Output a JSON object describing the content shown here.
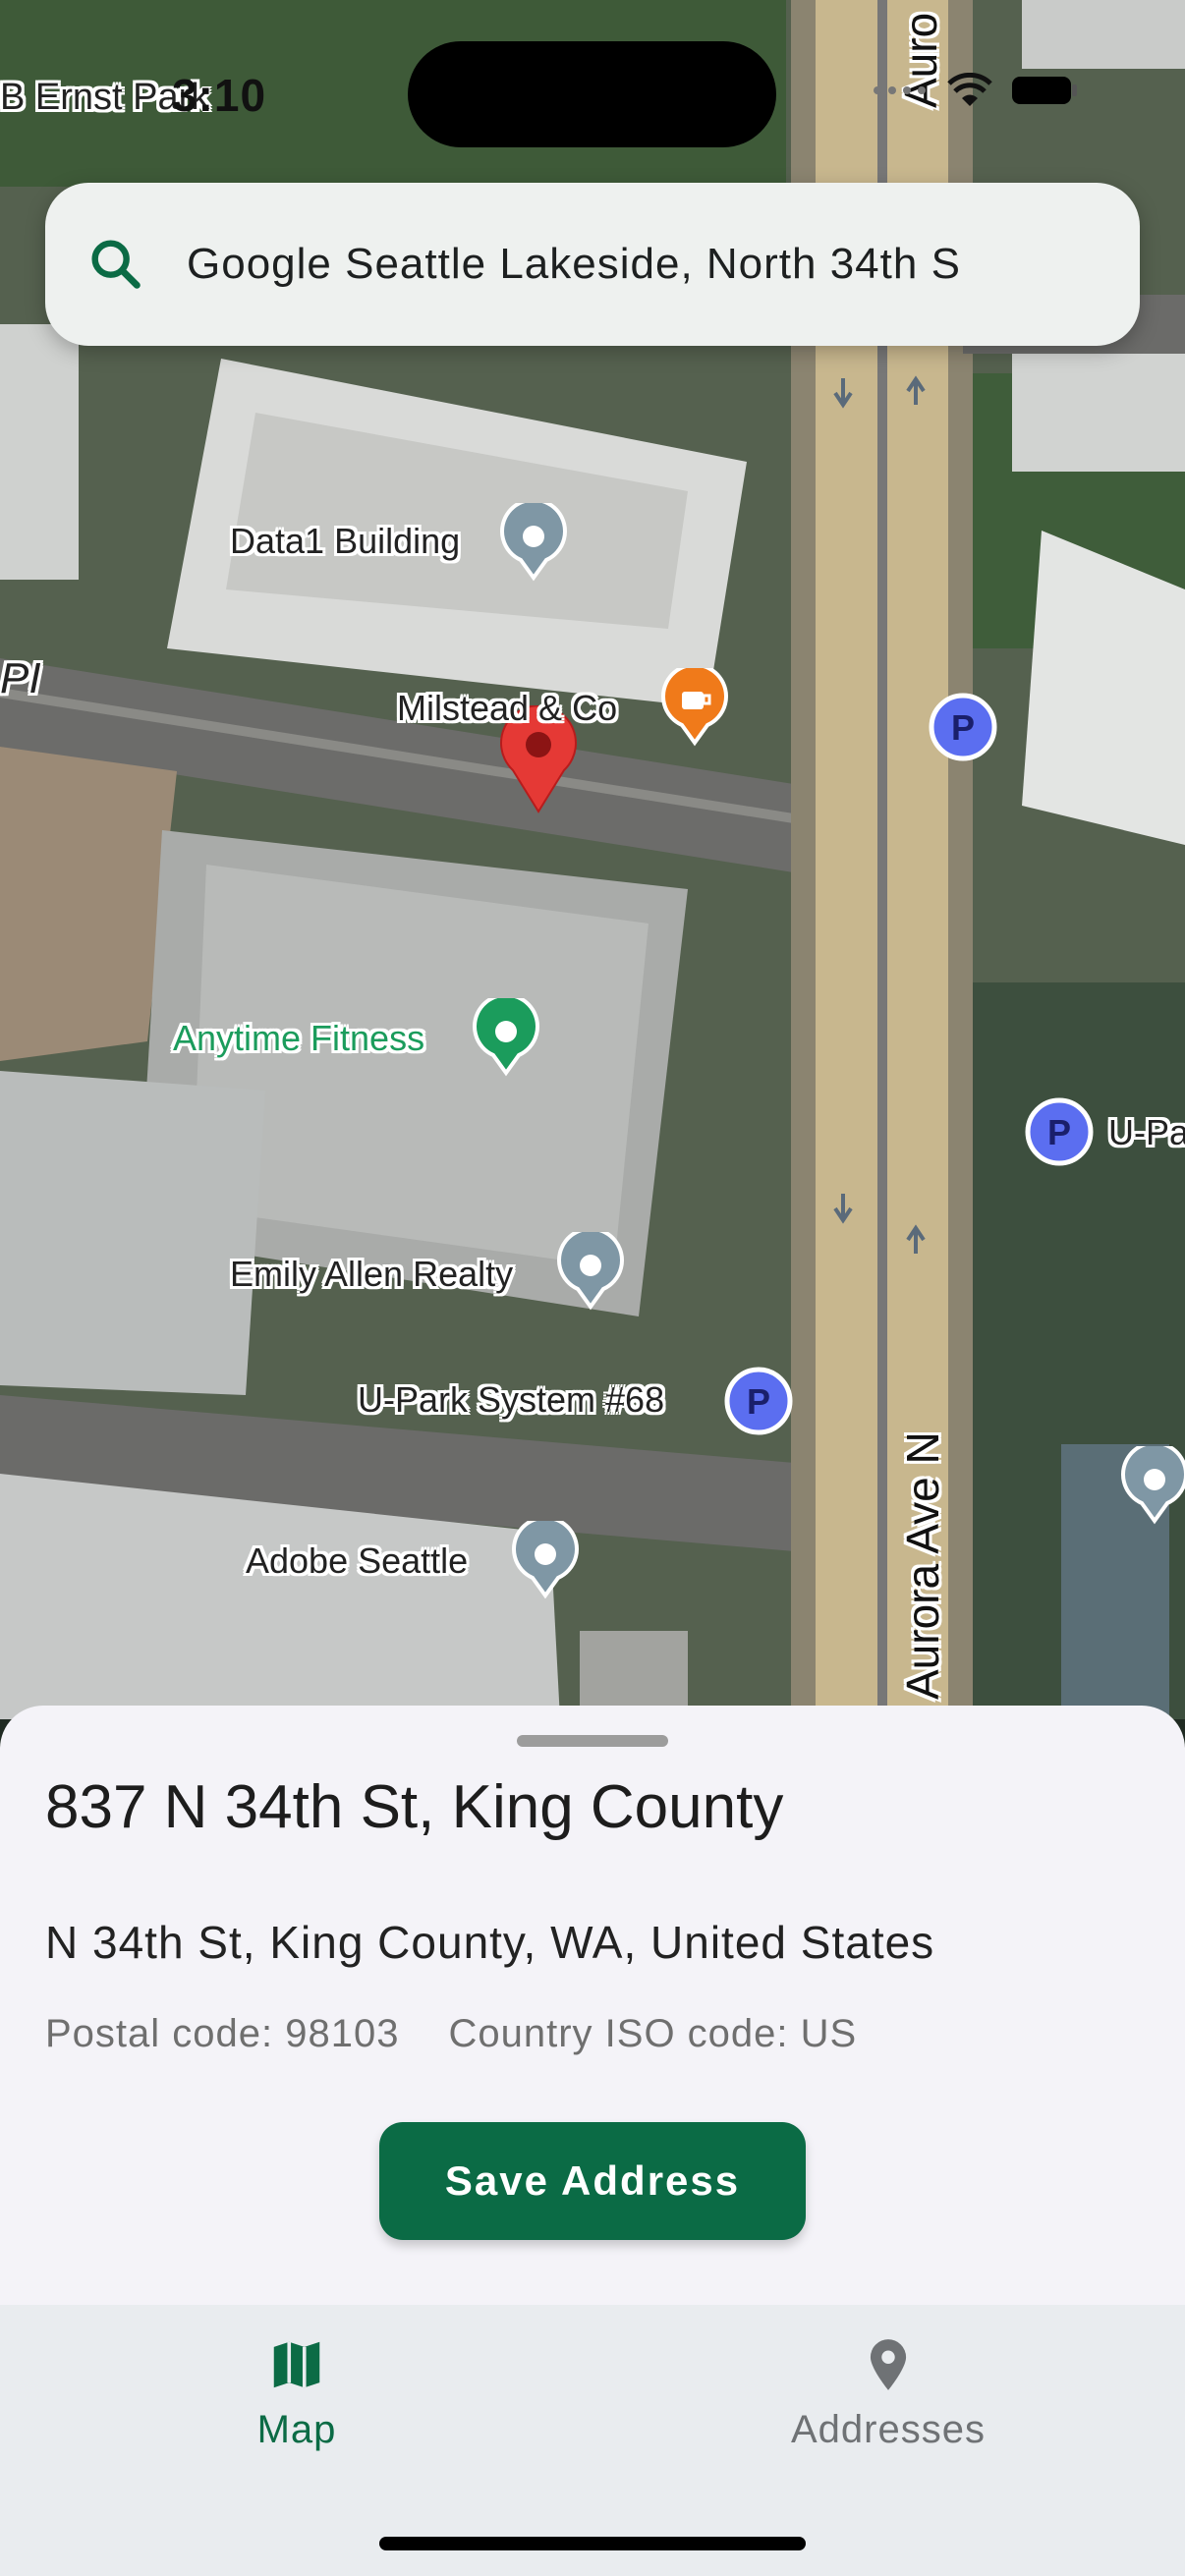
{
  "status_bar": {
    "time": "3:10"
  },
  "search": {
    "value": "Google Seattle Lakeside, North 34th S"
  },
  "map": {
    "place_labels": [
      "B Ernst Park",
      "Data1 Building",
      "Milstead & Co",
      "Anytime Fitness",
      "Emily Allen Realty",
      "U-Park System #68",
      "Adobe Seattle",
      "U-Pa"
    ],
    "road_labels": [
      "Aurora Ave N",
      "Auro",
      "PI"
    ],
    "colors": {
      "primary": "#0b6b45",
      "pin_red": "#e53935",
      "poi_gray": "#7f97a5",
      "poi_green": "#1b9c5c",
      "poi_orange": "#f07a1a",
      "parking": "#5b6ef0"
    }
  },
  "sheet": {
    "title": "837 N 34th St, King County",
    "subtitle": "N 34th St, King County, WA, United States",
    "postal": "Postal code: 98103",
    "iso": "Country ISO code: US",
    "save_label": "Save Address"
  },
  "nav": {
    "items": [
      {
        "label": "Map",
        "icon": "map-icon",
        "active": true
      },
      {
        "label": "Addresses",
        "icon": "location-pin-icon",
        "active": false
      }
    ]
  }
}
